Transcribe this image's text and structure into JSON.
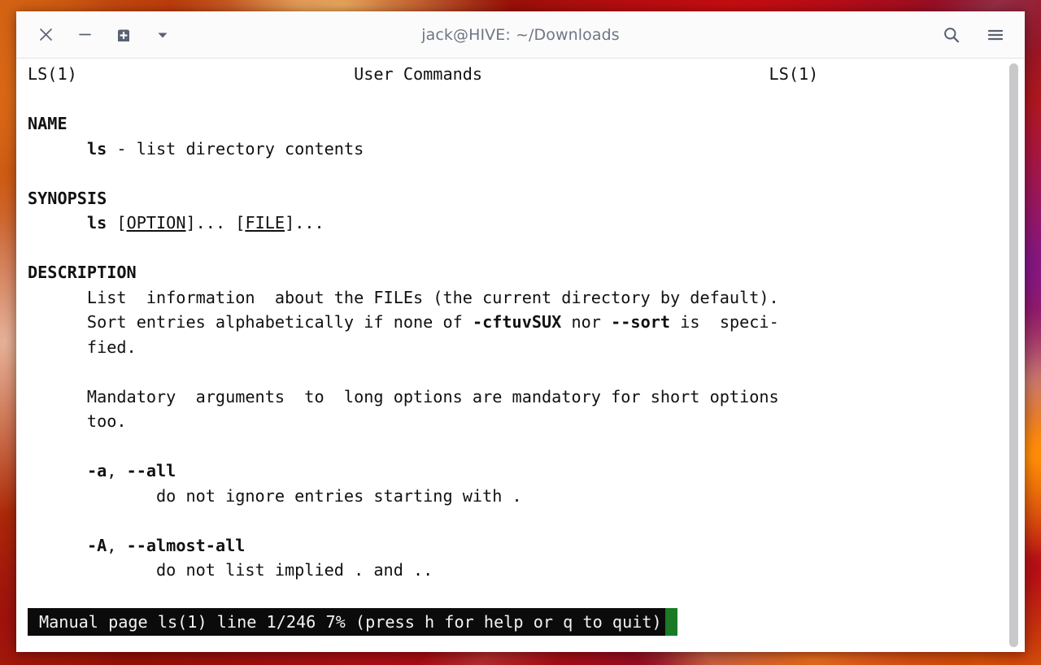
{
  "window": {
    "title": "jack@HIVE: ~/Downloads"
  },
  "titlebar": {
    "close_label": "Close",
    "minimize_label": "Minimize",
    "new_tab_label": "New Tab",
    "menu_dropdown_label": "Open dropdown",
    "search_label": "Search",
    "hamburger_label": "Menu",
    "icons": {
      "close": "close-icon",
      "minimize": "minimize-icon",
      "new_tab": "new-tab-icon",
      "chevron_down": "chevron-down-icon",
      "search": "search-icon",
      "hamburger": "hamburger-menu-icon"
    }
  },
  "manpage": {
    "header": {
      "left": "LS(1)",
      "center": "User Commands",
      "right": "LS(1)"
    },
    "sections": [
      {
        "heading": "NAME",
        "lines": [
          "      ls - list directory contents"
        ]
      },
      {
        "heading": "SYNOPSIS",
        "lines": [
          "      ls [OPTION]... [FILE]..."
        ]
      },
      {
        "heading": "DESCRIPTION",
        "lines": [
          "      List  information  about the FILEs (the current directory by default).",
          "      Sort entries alphabetically if none of -cftuvSUX nor --sort is  speci-",
          "      fied.",
          "",
          "      Mandatory  arguments  to  long options are mandatory for short options",
          "      too.",
          "",
          "      -a, --all",
          "             do not ignore entries starting with .",
          "",
          "      -A, --almost-all",
          "             do not list implied . and .."
        ]
      }
    ],
    "bold_tokens": [
      "NAME",
      "SYNOPSIS",
      "DESCRIPTION",
      "ls",
      "-cftuvSUX",
      "--sort",
      "-a",
      "--all",
      "-A",
      "--almost-all"
    ],
    "underlined_tokens": [
      "OPTION",
      "FILE"
    ]
  },
  "status": {
    "text": "Manual page ls(1) line 1/246 7% (press h for help or q to quit)",
    "manual_name": "ls(1)",
    "line_current": 1,
    "line_total": 246,
    "percent": "7%",
    "hint": "(press h for help or q to quit)",
    "cursor_color": "#1a7a26",
    "background": "#0b0b0b",
    "foreground": "#f2f2f2"
  },
  "scrollbar": {
    "thumb_color": "#c9c9cc",
    "position": "top"
  },
  "colors": {
    "window_background": "#ffffff",
    "titlebar_background": "#fbfbfb",
    "titlebar_text": "#6f7685",
    "terminal_text": "#111111",
    "desktop_accent": "#b03a10"
  }
}
